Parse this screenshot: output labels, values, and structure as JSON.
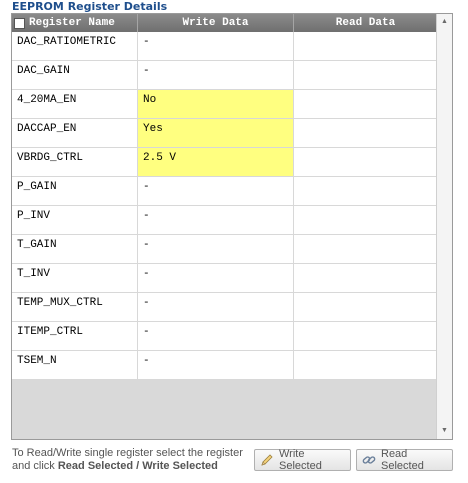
{
  "panel": {
    "title": "EEPROM Register Details"
  },
  "table": {
    "columns": {
      "name": "Register Name",
      "write": "Write Data",
      "read": "Read Data"
    },
    "rows": [
      {
        "name": "DAC_RATIOMETRIC",
        "write": "-",
        "read": ""
      },
      {
        "name": "DAC_GAIN",
        "write": "-",
        "read": ""
      },
      {
        "name": "4_20MA_EN",
        "write": "No",
        "read": ""
      },
      {
        "name": "DACCAP_EN",
        "write": "Yes",
        "read": ""
      },
      {
        "name": "VBRDG_CTRL",
        "write": "2.5 V",
        "read": ""
      },
      {
        "name": "P_GAIN",
        "write": "-",
        "read": ""
      },
      {
        "name": "P_INV",
        "write": "-",
        "read": ""
      },
      {
        "name": "T_GAIN",
        "write": "-",
        "read": ""
      },
      {
        "name": "T_INV",
        "write": "-",
        "read": ""
      },
      {
        "name": "TEMP_MUX_CTRL",
        "write": "-",
        "read": ""
      },
      {
        "name": "ITEMP_CTRL",
        "write": "-",
        "read": ""
      },
      {
        "name": "TSEM_N",
        "write": "-",
        "read": ""
      }
    ],
    "highlight_color": "#ffff80"
  },
  "footer": {
    "hint_line1": "To Read/Write single register select the register",
    "hint_line2_prefix": "and click ",
    "hint_line2_bold": "Read Selected / Write Selected"
  },
  "buttons": {
    "write_selected": "Write Selected",
    "read_selected": "Read Selected"
  },
  "icons": {
    "write": "pencil-icon",
    "read": "link-icon"
  }
}
